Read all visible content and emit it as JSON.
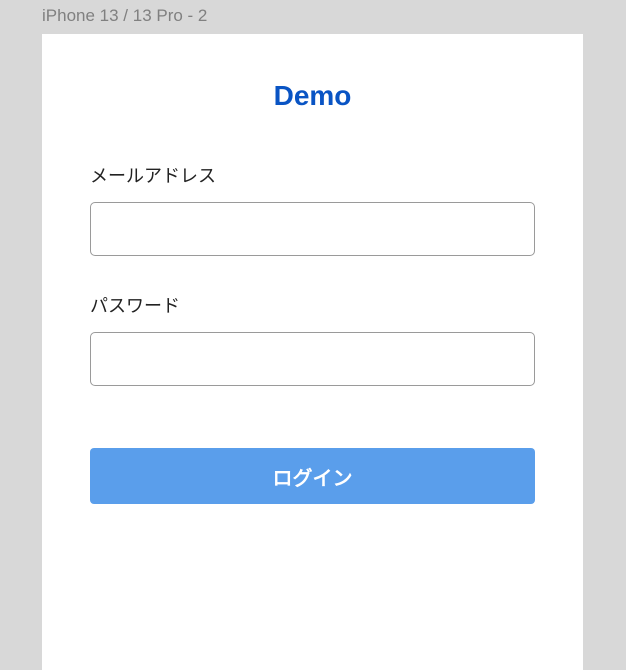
{
  "frame": {
    "label": "iPhone 13 / 13 Pro - 2"
  },
  "app": {
    "title": "Demo"
  },
  "form": {
    "email": {
      "label": "メールアドレス",
      "value": ""
    },
    "password": {
      "label": "パスワード",
      "value": ""
    },
    "login_button": "ログイン"
  }
}
